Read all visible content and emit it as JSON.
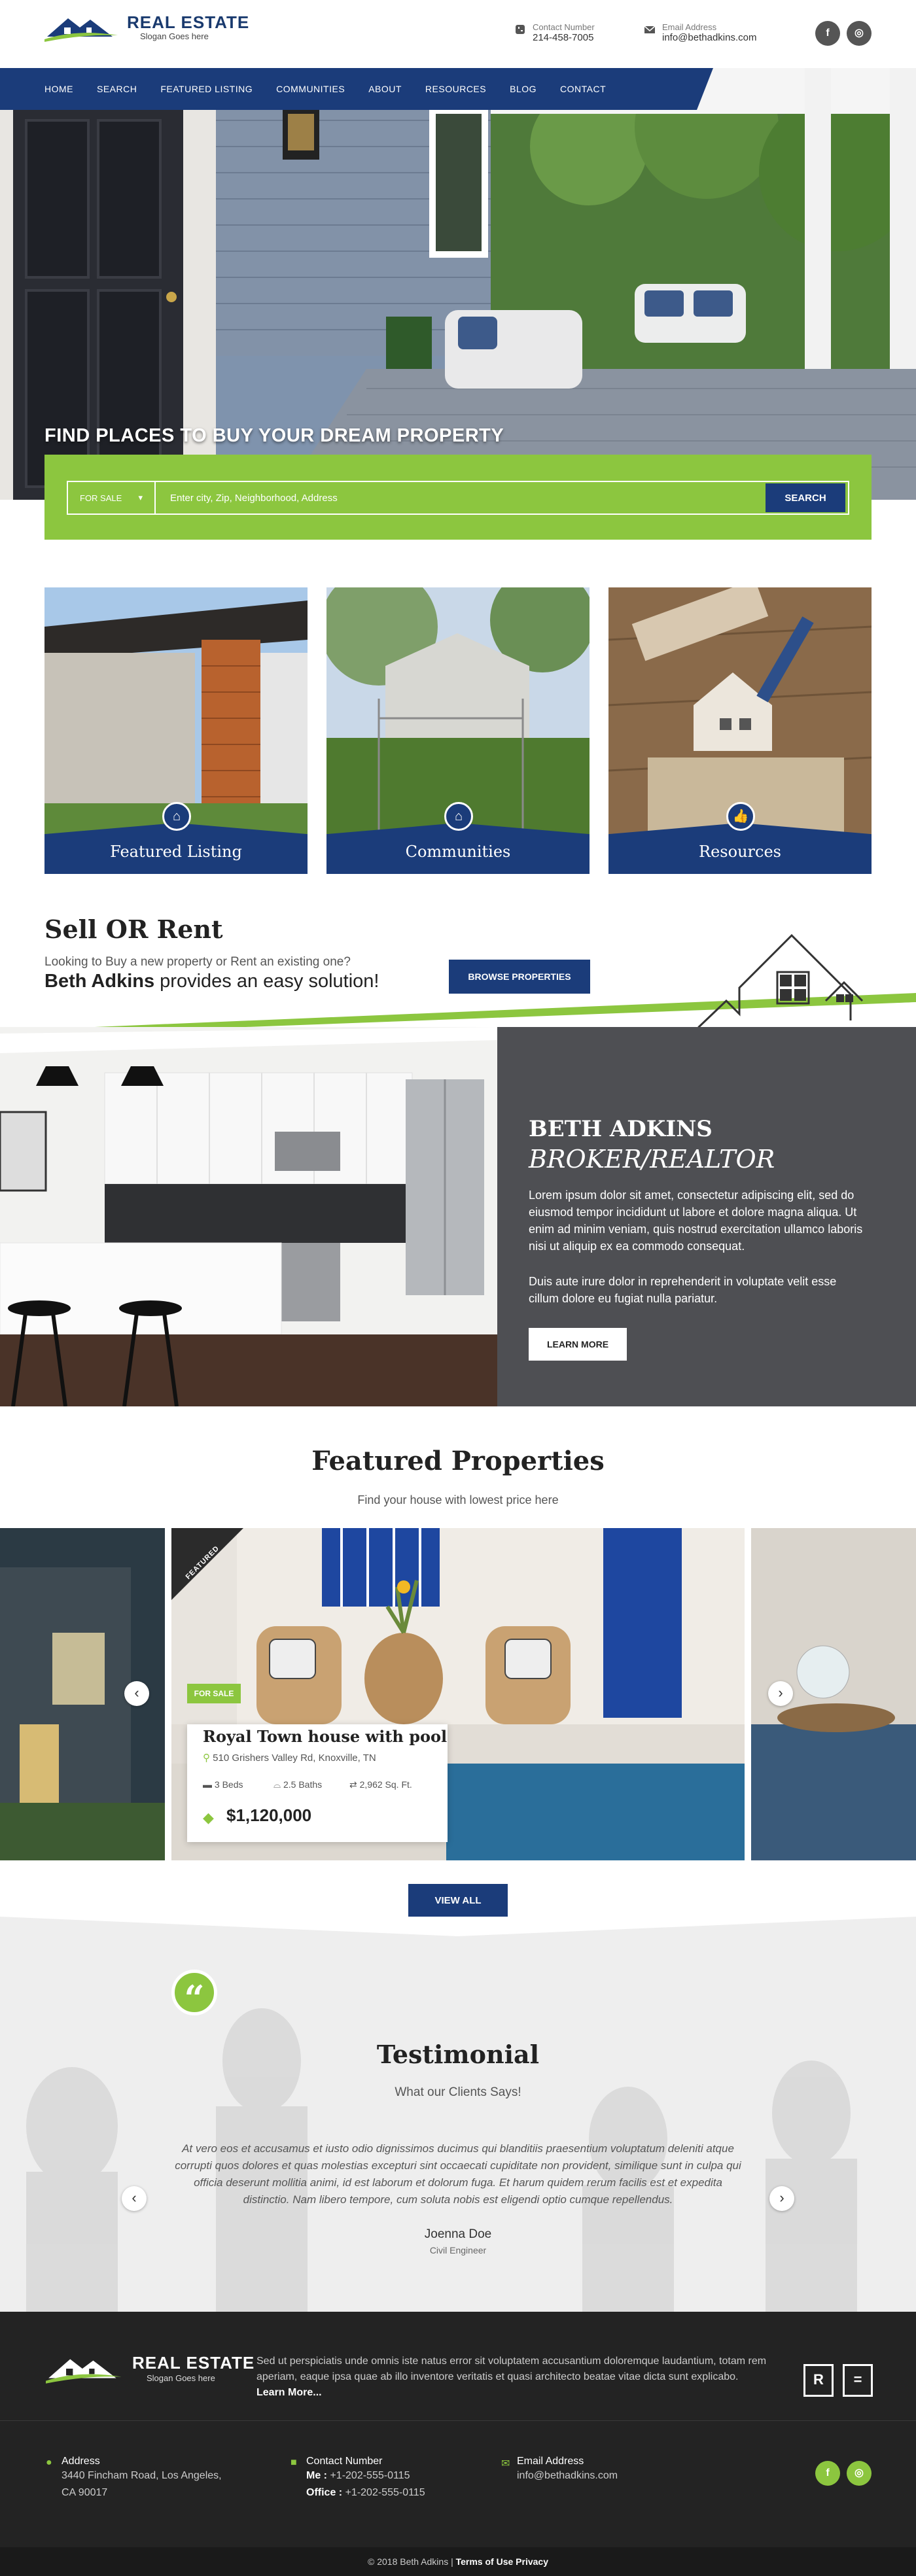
{
  "header": {
    "brand": "REAL ESTATE",
    "slogan": "Slogan Goes here",
    "contact_label": "Contact Number",
    "contact_value": "214-458-7005",
    "email_label": "Email Address",
    "email_value": "info@bethadkins.com",
    "social": [
      "facebook-icon",
      "instagram-icon"
    ]
  },
  "nav": {
    "items": [
      "HOME",
      "SEARCH",
      "FEATURED LISTING",
      "COMMUNITIES",
      "ABOUT",
      "RESOURCES",
      "BLOG",
      "CONTACT"
    ]
  },
  "hero": {
    "title": "FIND PLACES TO BUY YOUR DREAM PROPERTY",
    "select_value": "FOR SALE",
    "search_placeholder": "Enter city, Zip, Neighborhood, Address",
    "search_button": "SEARCH"
  },
  "categories": [
    {
      "label": "Featured Listing",
      "icon": "star-house-icon"
    },
    {
      "label": "Communities",
      "icon": "home-icon"
    },
    {
      "label": "Resources",
      "icon": "thumbs-up-icon"
    }
  ],
  "sell": {
    "title": "Sell OR Rent",
    "subtitle": "Looking to Buy a new property or Rent an existing one?",
    "name": "Beth Adkins",
    "tagline": "provides an easy solution!",
    "button": "BROWSE PROPERTIES"
  },
  "broker": {
    "name": "BETH ADKINS",
    "role": "BROKER/REALTOR",
    "p1": "Lorem ipsum dolor sit amet, consectetur adipiscing elit, sed do eiusmod tempor incididunt ut labore et dolore magna aliqua. Ut enim ad minim veniam, quis nostrud exercitation ullamco laboris nisi ut aliquip ex ea commodo consequat.",
    "p2": "Duis aute irure dolor in reprehenderit in voluptate velit esse cillum dolore eu fugiat nulla pariatur.",
    "button": "LEARN MORE"
  },
  "featured": {
    "title": "Featured Properties",
    "subtitle": "Find your house with lowest price here",
    "ribbon": "FEATURED",
    "badge": "FOR SALE",
    "property_title": "Royal Town house with pool",
    "address": "510 Grishers Valley Rd, Knoxville, TN",
    "beds": "3 Beds",
    "baths": "2.5 Baths",
    "area": "2,962 Sq. Ft.",
    "price": "$1,120,000",
    "button": "VIEW ALL"
  },
  "testimonial": {
    "title": "Testimonial",
    "subtitle": "What our Clients Says!",
    "body": "At vero eos et accusamus et iusto odio dignissimos ducimus qui blanditiis praesentium voluptatum deleniti atque corrupti quos dolores et quas molestias excepturi sint occaecati cupiditate non provident, similique sunt in culpa qui officia deserunt mollitia animi, id est laborum et dolorum fuga. Et harum quidem rerum facilis est et expedita distinctio. Nam libero tempore, cum soluta nobis est eligendi optio cumque repellendus.",
    "name": "Joenna Doe",
    "role": "Civil Engineer"
  },
  "footer": {
    "brand": "REAL ESTATE",
    "slogan": "Slogan Goes here",
    "about": "Sed ut perspiciatis unde omnis iste natus error sit voluptatem accusantium doloremque laudantium, totam rem aperiam, eaque ipsa quae ab illo inventore veritatis et quasi architecto beatae vitae dicta sunt explicabo.",
    "read_more": "Learn More...",
    "address_label": "Address",
    "address_1": "3440 Fincham Road, Los Angeles,",
    "address_2": "CA 90017",
    "contact_label": "Contact Number",
    "me_label": "Me :",
    "me_value": "+1-202-555-0115",
    "office_label": "Office :",
    "office_value": "+1-202-555-0115",
    "email_label": "Email Address",
    "email_value": "info@bethadkins.com",
    "copyright": "© 2018 Beth Adkins |",
    "terms": "Terms of Use Privacy",
    "badges": [
      "R",
      "="
    ]
  },
  "colors": {
    "navy": "#1b3c7a",
    "green": "#8cc63f",
    "dark": "#232323"
  }
}
